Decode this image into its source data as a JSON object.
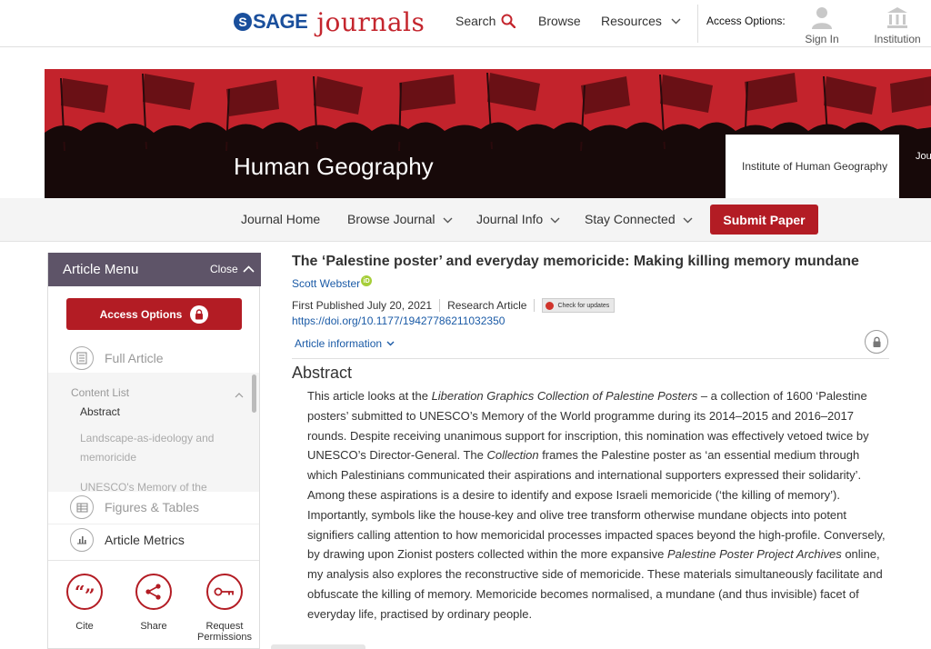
{
  "header": {
    "logo_sage": "SAGE",
    "logo_journals": "journals",
    "nav": {
      "search": "Search",
      "browse": "Browse",
      "resources": "Resources"
    },
    "access_options_label": "Access Options:",
    "sign_in": "Sign In",
    "institution": "Institution"
  },
  "banner": {
    "journal_title": "Human Geography",
    "institute": "Institute of Human Geography",
    "extra_cut": "Jou"
  },
  "journal_nav": {
    "home": "Journal Home",
    "browse": "Browse Journal",
    "info": "Journal Info",
    "stay": "Stay Connected",
    "submit": "Submit Paper"
  },
  "sidebar": {
    "title": "Article Menu",
    "close": "Close",
    "access_button": "Access Options",
    "full_article": "Full Article",
    "content_list": {
      "heading": "Content List",
      "items": [
        "Abstract",
        "Landscape-as-ideology and memoricide",
        "UNESCO's Memory of the World"
      ]
    },
    "figures_tables": "Figures & Tables",
    "article_metrics": "Article Metrics",
    "tools": {
      "cite": "Cite",
      "share": "Share",
      "request": "Request Permissions"
    }
  },
  "article": {
    "title": "The ‘Palestine poster’ and everyday memoricide: Making killing memory mundane",
    "author": "Scott Webster",
    "first_published": "First Published July 20, 2021",
    "type": "Research Article",
    "check_updates": "Check for updates",
    "doi": "https://doi.org/10.1177/19427786211032350",
    "article_information": "Article information",
    "abstract_heading": "Abstract",
    "abstract": {
      "p1": "This article looks at the ",
      "i1": "Liberation Graphics Collection of Palestine Posters",
      "p2": " – a collection of 1600 ‘Palestine posters’ submitted to UNESCO’s Memory of the World programme during its 2014–2015 and 2016–2017 rounds. Despite receiving unanimous support for inscription, this nomination was effectively vetoed twice by UNESCO’s Director-General. The ",
      "i2": "Collection",
      "p3": " frames the Palestine poster as ‘an essential medium through which Palestinians communicated their aspirations and international supporters expressed their solidarity’. Among these aspirations is a desire to identify and expose Israeli memoricide (‘the killing of memory’). Importantly, symbols like the house-key and olive tree transform otherwise mundane objects into potent signifiers calling attention to how memoricidal processes impacted spaces beyond the high-profile. Conversely, by drawing upon Zionist posters collected within the more expansive ",
      "i3": "Palestine Poster Project Archives",
      "p4": " online, my analysis also explores the reconstructive side of memoricide. These materials simultaneously facilitate and obfuscate the killing of memory. Memoricide becomes normalised, a mundane (and thus invisible) facet of everyday life, practised by ordinary people."
    }
  },
  "colors": {
    "brand_red": "#b31c24",
    "menu_purple": "#5e5468",
    "link_blue": "#1a5aa6",
    "sage_blue": "#1a4f9c"
  }
}
